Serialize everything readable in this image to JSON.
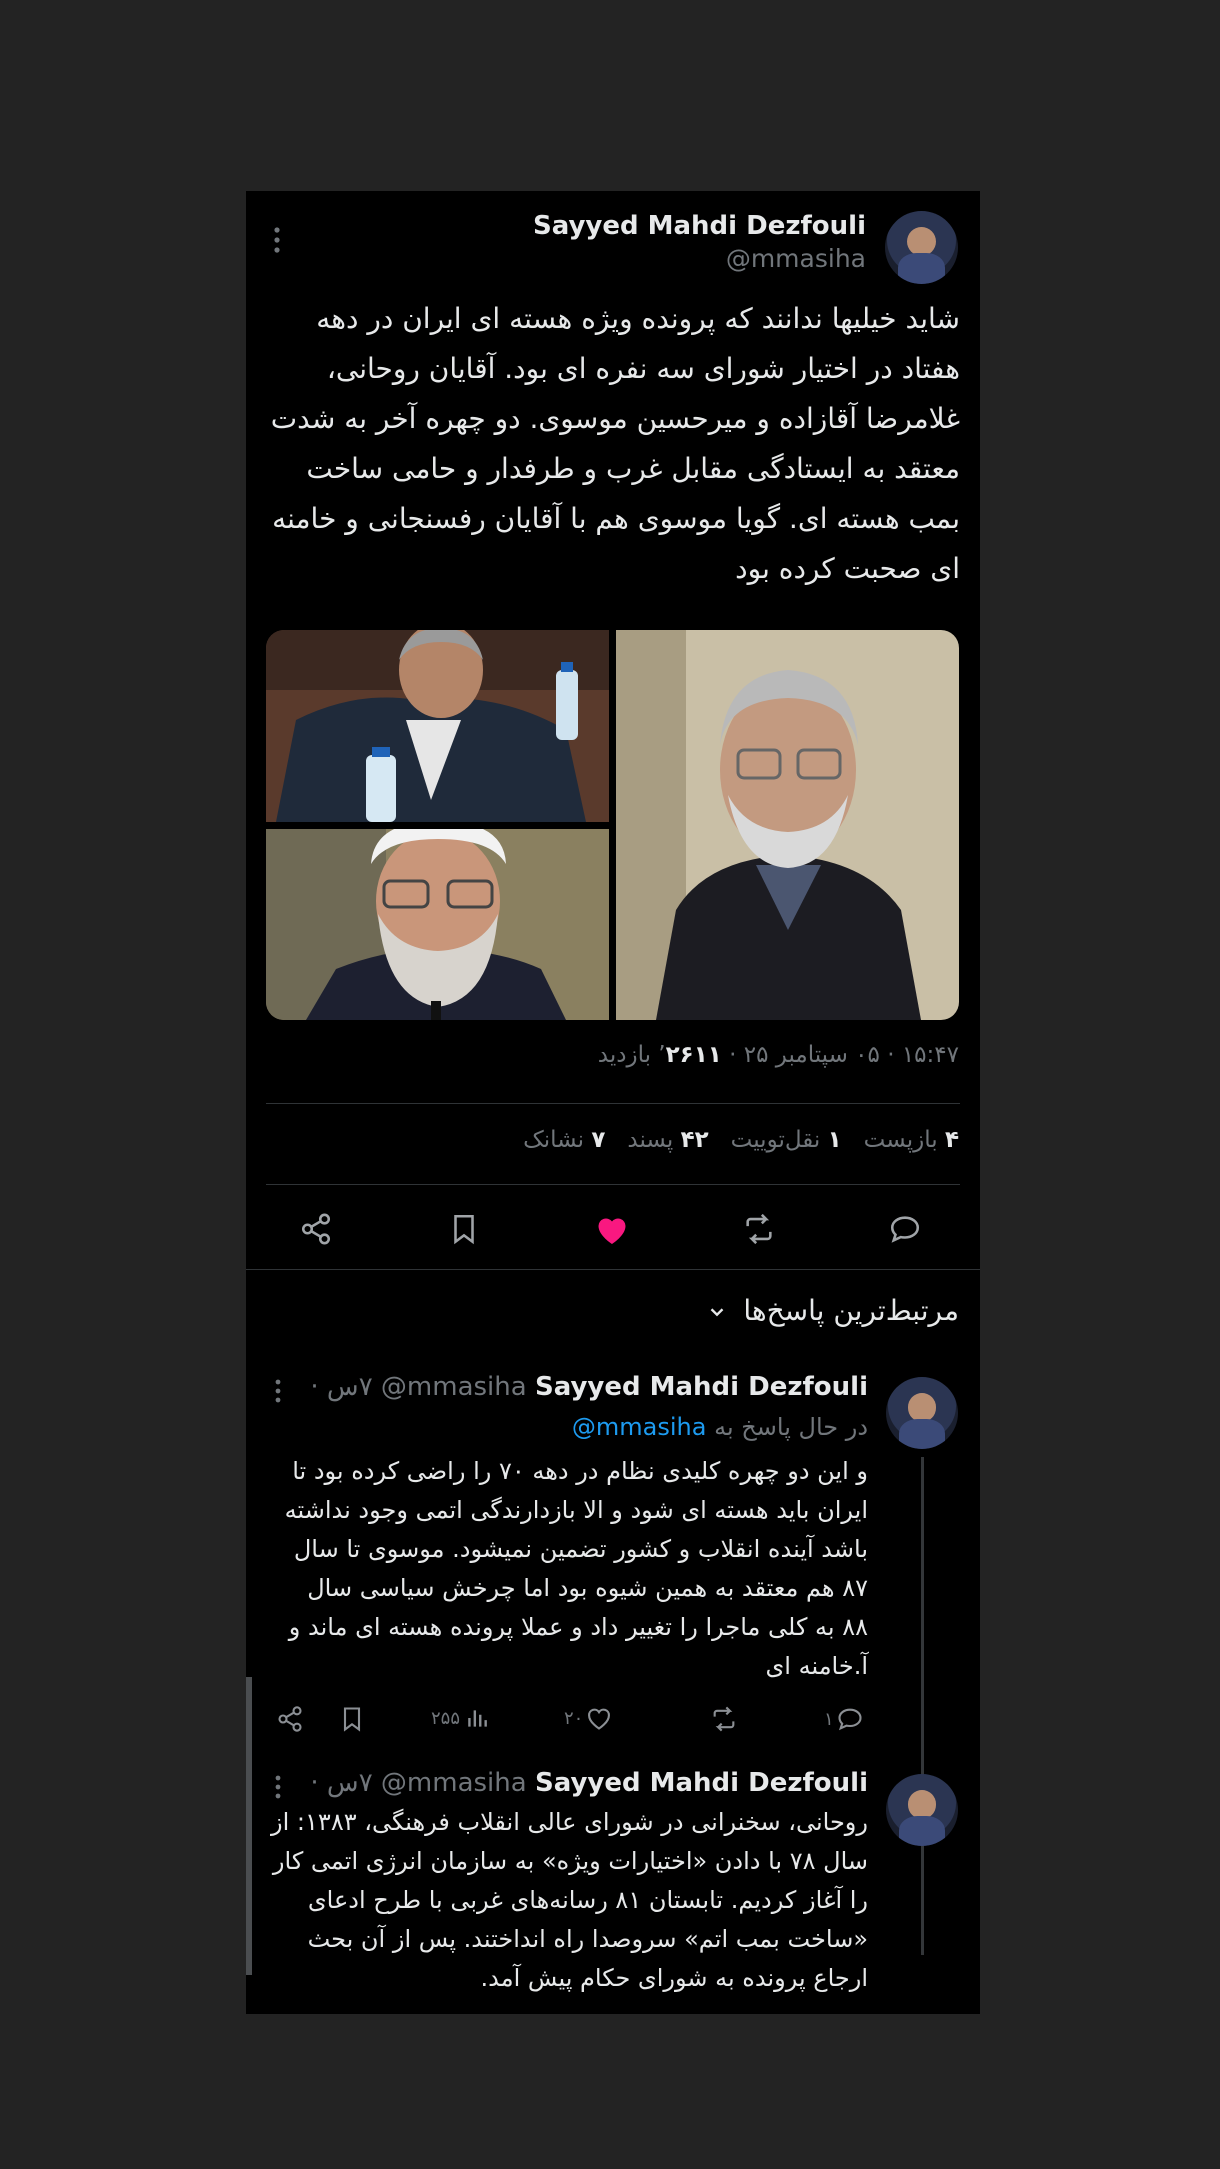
{
  "tweet": {
    "author_name": "Sayyed Mahdi Dezfouli",
    "author_handle": "@mmasiha",
    "text": "شاید خیلیها ندانند که پرونده ویژه هسته ای ایران در دهه هفتاد در اختیار شورای سه نفره ای بود. آقایان روحانی، غلامرضا آقازاده و میرحسین موسوی. دو چهره آخر به شدت معتقد به ایستادگی مقابل غرب و طرفدار و حامی ساخت بمب هسته ای. گویا موسوی هم با آقایان رفسنجانی و خامنه ای صحبت کرده بود",
    "meta_time": "۱۵:۴۷ · ۰۵ سپتامبر ۲۵ · ",
    "meta_views_num": "۲۶۱۱",
    "meta_views_label": "’ بازدید",
    "stats": [
      {
        "num": "۴",
        "label": "بازپست"
      },
      {
        "num": "۱",
        "label": "نقل‌توییت"
      },
      {
        "num": "۴۲",
        "label": "پسند"
      },
      {
        "num": "۷",
        "label": "نشانک"
      }
    ],
    "colors": {
      "like": "#f91880",
      "link": "#1d9bf0"
    }
  },
  "action_icons": [
    "comment-icon",
    "retweet-icon",
    "heart-icon",
    "bookmark-icon",
    "share-icon"
  ],
  "replies_header": "مرتبط‌ترین پاسخ‌ها",
  "replies": [
    {
      "author_name": "Sayyed Mahdi Dezfouli",
      "author_handle": "@mmasiha",
      "time": "۷س ·",
      "replying_prefix": "در حال پاسخ به",
      "replying_to": "@mmasiha",
      "lines": [
        "و این دو چهره کلیدی نظام در دهه ۷۰ را راضی کرده بود تا",
        "ایران باید هسته ای شود و الا بازدارندگی اتمی وجود نداشته",
        "باشد آینده انقلاب و کشور تضمین نمیشود. موسوی تا سال",
        "۸۷ هم معتقد به همین شیوه بود اما چرخش سیاسی سال",
        "۸۸ به کلی ماجرا را تغییر داد و عملا پرونده هسته ای ماند و",
        "آ.خامنه ای"
      ],
      "reply_count": "۱",
      "like_count": "۲۰",
      "views_count": "۲۵۵"
    },
    {
      "author_name": "Sayyed Mahdi Dezfouli",
      "author_handle": "@mmasiha",
      "time": "۷س ·",
      "lines": [
        "روحانی، سخنرانی در شورای عالی انقلاب فرهنگی، ۱۳۸۳: از",
        "سال ۷۸ با دادن «اختیارات ویژه» به سازمان انرژی اتمی کار",
        "را آغاز کردیم. تابستان ۸۱ رسانه‌های غربی با طرح ادعای",
        "«ساخت بمب اتم» سروصدا راه انداختند. پس از آن بحث",
        "ارجاع پرونده به شورای حکام پیش آمد."
      ]
    }
  ]
}
